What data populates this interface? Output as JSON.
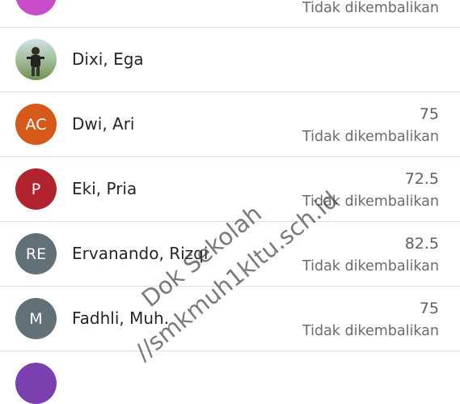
{
  "students": [
    {
      "initials": "",
      "name": "",
      "grade": "",
      "status": "Tidak dikembalikan",
      "avatar_color": "#c84bc7"
    },
    {
      "initials": "",
      "name": "Dixi, Ega",
      "grade": "",
      "status": "",
      "avatar_color": "#5b7a3e",
      "avatar_photo": true
    },
    {
      "initials": "AC",
      "name": "Dwi, Ari",
      "grade": "75",
      "status": "Tidak dikembalikan",
      "avatar_color": "#d55a1a"
    },
    {
      "initials": "P",
      "name": "Eki, Pria",
      "grade": "72.5",
      "status": "Tidak dikembalikan",
      "avatar_color": "#b0232f"
    },
    {
      "initials": "RE",
      "name": "Ervanando, Rizqi",
      "grade": "82.5",
      "status": "Tidak dikembalikan",
      "avatar_color": "#627177"
    },
    {
      "initials": "M",
      "name": "Fadhli, Muh.",
      "grade": "75",
      "status": "Tidak dikembalikan",
      "avatar_color": "#627177"
    },
    {
      "initials": "",
      "name": "",
      "grade": "",
      "status": "",
      "avatar_color": "#7b3fb0"
    }
  ],
  "watermark": {
    "line1": "Dok Sekolah",
    "line2": "//smkmuh1kltu.sch.id"
  }
}
